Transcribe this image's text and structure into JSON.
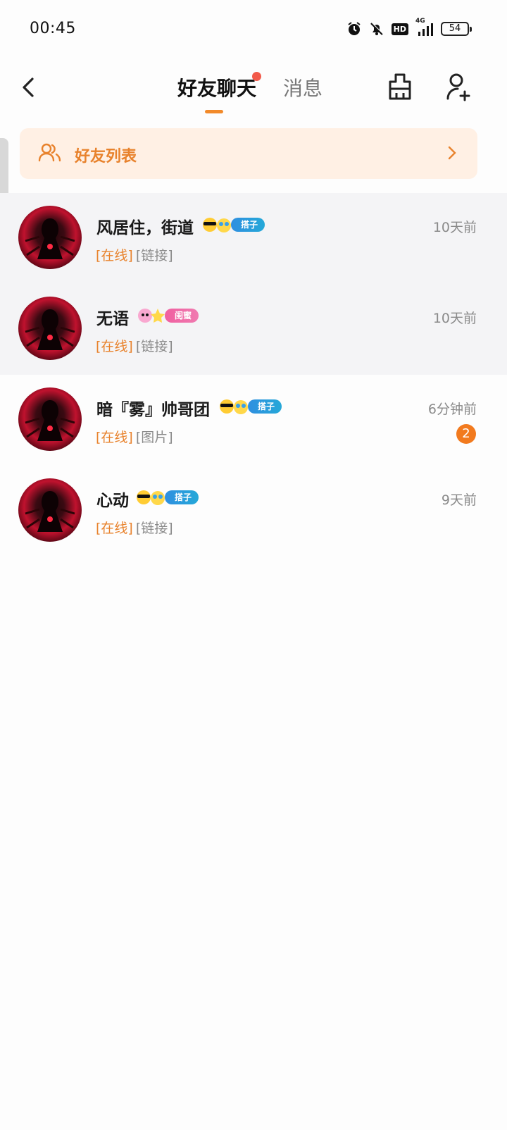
{
  "status_bar": {
    "time": "00:45",
    "icons": [
      "alarm-icon",
      "mute-bell-icon",
      "hd-icon",
      "signal-4g-icon",
      "battery-icon"
    ],
    "hd": "HD",
    "network": "4G",
    "battery": "54"
  },
  "header": {
    "tabs": [
      {
        "label": "好友聊天",
        "active": true,
        "has_dot": true
      },
      {
        "label": "消息",
        "active": false
      }
    ],
    "colors": {
      "accent": "#f28a2a",
      "dot": "#f25a4a"
    }
  },
  "friend_list": {
    "label": "好友列表"
  },
  "chats": [
    {
      "name": "风居住，街道",
      "relation": "搭子",
      "time": "10天前",
      "status": "[在线]",
      "preview": "[链接]",
      "unread": null
    },
    {
      "name": "无语",
      "relation": "闺蜜",
      "time": "10天前",
      "status": "[在线]",
      "preview": "[链接]",
      "unread": null
    },
    {
      "name": "暗『雾』帅哥团",
      "relation": "搭子",
      "time": "6分钟前",
      "status": "[在线]",
      "preview": "[图片]",
      "unread": "2"
    },
    {
      "name": "心动",
      "relation": "搭子",
      "time": "9天前",
      "status": "[在线]",
      "preview": "[链接]",
      "unread": null
    }
  ]
}
